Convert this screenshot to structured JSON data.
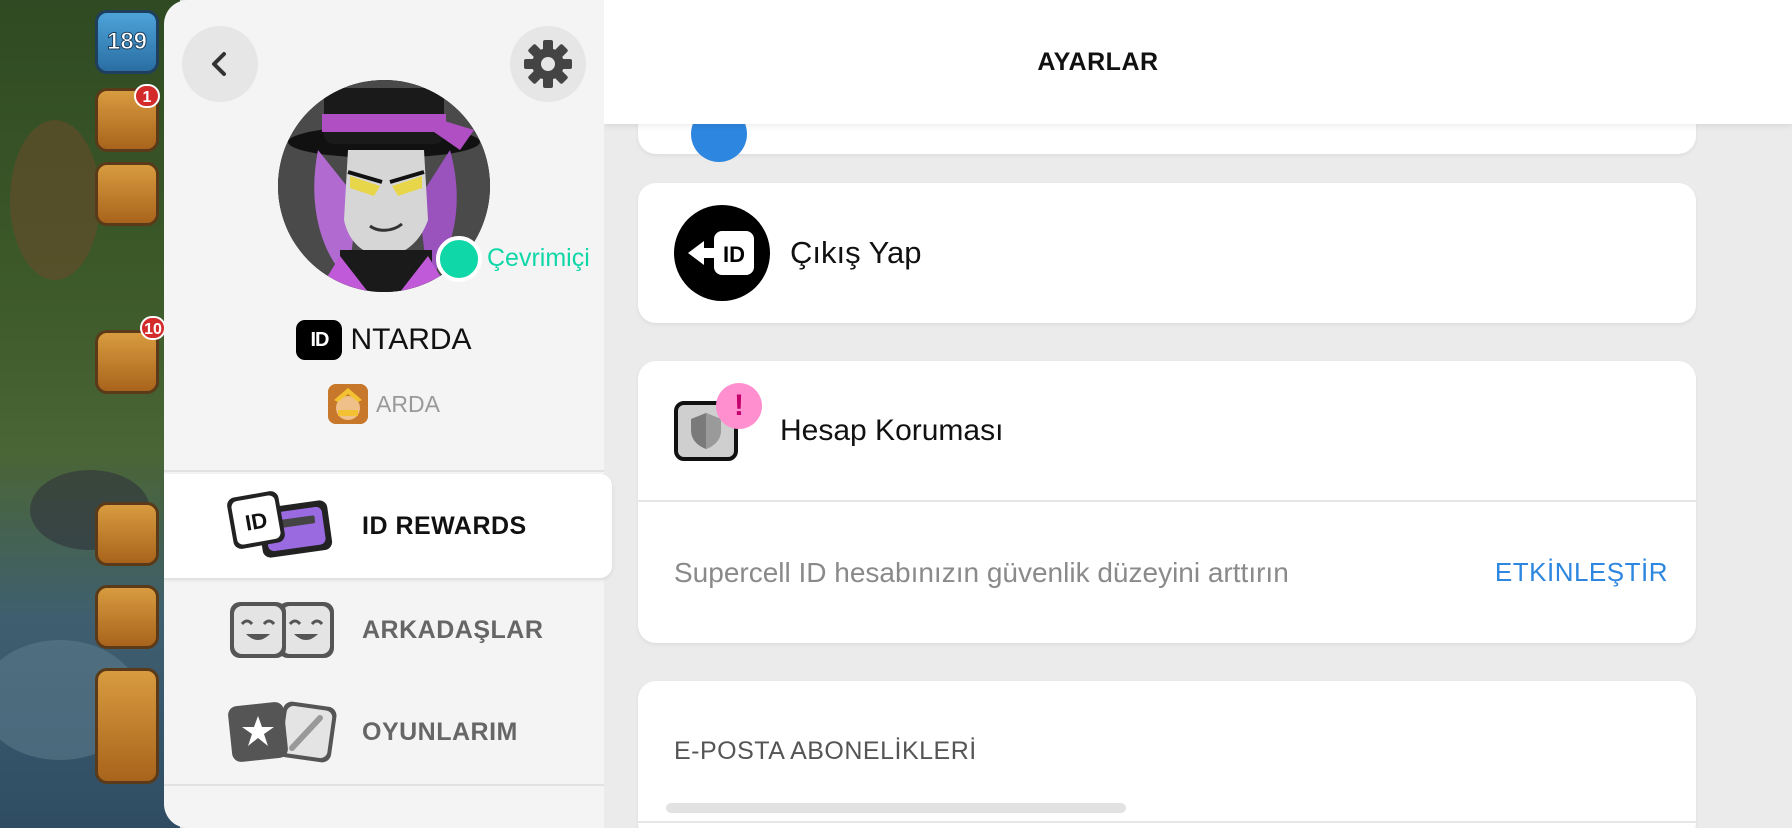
{
  "game_background": {
    "level": "189",
    "badge_top": "1",
    "badge_chat": "10"
  },
  "header": {
    "title": "AYARLAR"
  },
  "drawer": {
    "status": "Çevrimiçi",
    "id_badge": "ID",
    "username": "NTARDA",
    "game_player": "ARDA",
    "menu": [
      {
        "label": "ID REWARDS",
        "active": true
      },
      {
        "label": "ARKADAŞLAR",
        "active": false
      },
      {
        "label": "OYUNLARIM",
        "active": false
      }
    ]
  },
  "settings": {
    "logout": {
      "label": "Çıkış Yap",
      "icon_text": "ID"
    },
    "protection": {
      "title": "Hesap Koruması",
      "alert": "!",
      "description": "Supercell ID hesabınızın güvenlik düzeyini arttırın",
      "action": "ETKİNLEŞTİR"
    },
    "email": {
      "heading": "E-POSTA ABONELİKLERİ"
    }
  },
  "colors": {
    "online": "#10d7a8",
    "link": "#2d86e0",
    "alert_bg": "#ff8fcf"
  }
}
